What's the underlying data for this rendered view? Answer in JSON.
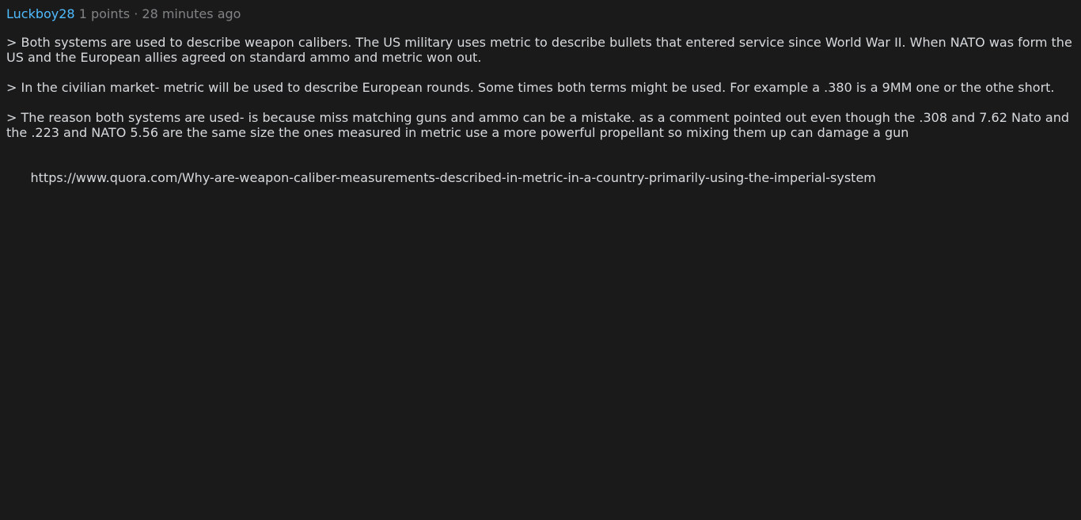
{
  "comment": {
    "author": "Luckboy28",
    "points": "1 points",
    "separator": "·",
    "timestamp": "28 minutes ago",
    "paragraphs": [
      "> Both systems are used to describe weapon calibers. The US military uses metric to describe bullets that entered service since World War II. When NATO was form the US and the European allies agreed on standard ammo and metric won out.",
      "> In the civilian market- metric will be used to describe European rounds. Some times both terms might be used. For example a .380 is a 9MM one or the othe short.",
      "> The reason both systems are used- is because miss matching guns and ammo can be a mistake. as a comment pointed out even though the .308 and 7.62 Nato and the .223 and NATO 5.56 are the same size the ones measured in metric use a more powerful propellant so mixing them up can damage a gun"
    ],
    "link": "https://www.quora.com/Why-are-weapon-caliber-measurements-described-in-metric-in-a-country-primarily-using-the-imperial-system"
  },
  "colors": {
    "background": "#1a1a1b",
    "text": "#d7dadc",
    "author": "#4fbcff",
    "meta": "#818384"
  }
}
